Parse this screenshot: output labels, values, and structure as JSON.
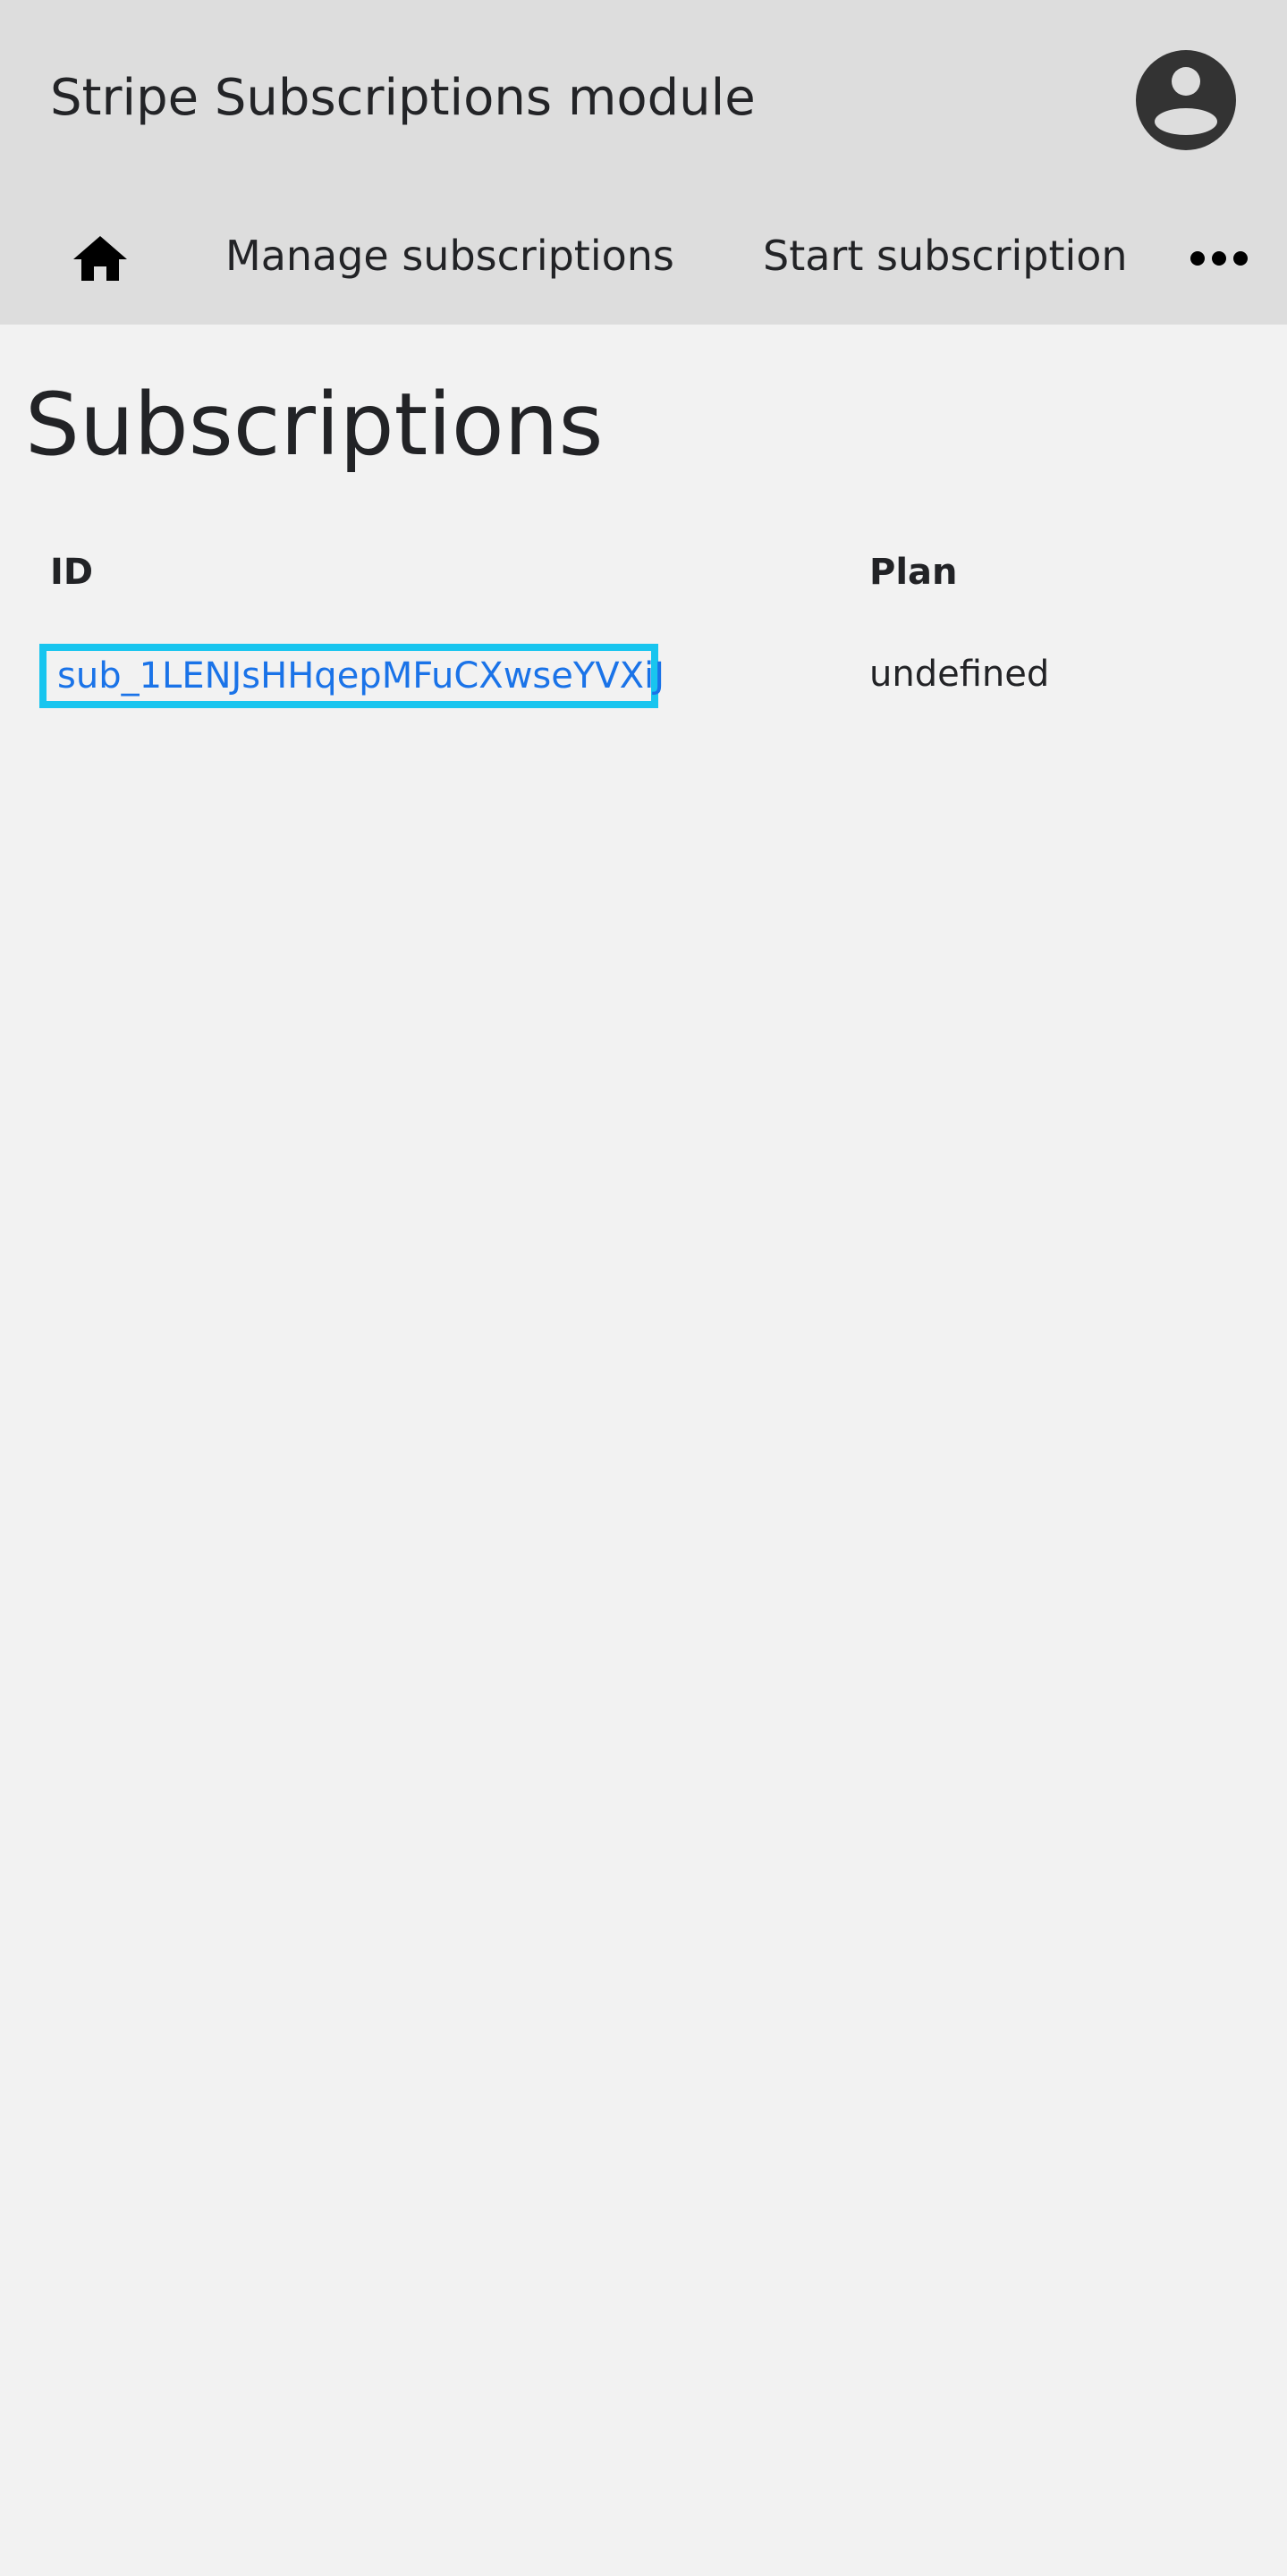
{
  "header": {
    "app_title": "Stripe Subscriptions module",
    "avatar_icon": "account-circle-icon"
  },
  "nav": {
    "home_icon": "home-icon",
    "items": [
      {
        "label": "Manage subscriptions"
      },
      {
        "label": "Start subscription"
      }
    ],
    "more_icon": "more-horizontal-icon"
  },
  "main": {
    "title": "Subscriptions",
    "table": {
      "columns": [
        "ID",
        "Plan"
      ],
      "rows": [
        {
          "id": "sub_1LENJsHHqepMFuCXwseYVXiJ",
          "plan": "undefined"
        }
      ]
    }
  },
  "colors": {
    "header_bg": "#dddddd",
    "page_bg": "#f2f2f2",
    "link": "#1a73e8",
    "focus_ring": "#18c5ef",
    "avatar": "#333333"
  }
}
